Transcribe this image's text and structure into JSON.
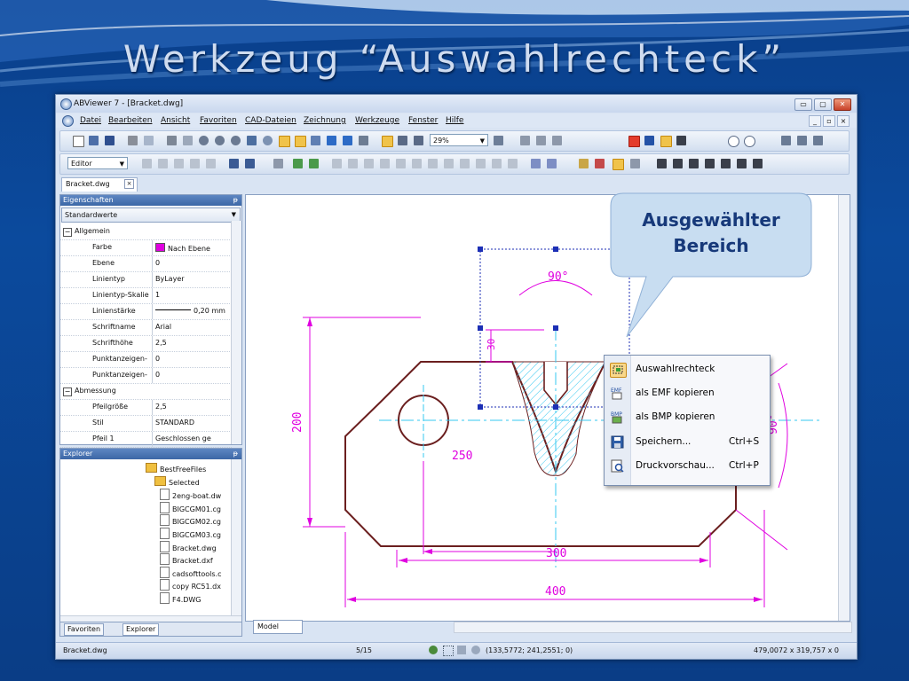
{
  "slide": {
    "title": "Werkzeug “Auswahlrechteck”"
  },
  "window": {
    "title": "ABViewer 7 - [Bracket.dwg]",
    "buttons": [
      "▭",
      "▢",
      "✕"
    ]
  },
  "menu": {
    "items": [
      "Datei",
      "Bearbeiten",
      "Ansicht",
      "Favoriten",
      "CAD-Dateien",
      "Zeichnung",
      "Werkzeuge",
      "Fenster",
      "Hilfe"
    ],
    "mdi_buttons": [
      "_",
      "▫",
      "×"
    ]
  },
  "toolbar": {
    "zoom_value": "29%",
    "mode_value": "Editor"
  },
  "doc_tab": {
    "label": "Bracket.dwg"
  },
  "properties": {
    "header": "Eigenschaften",
    "preset": "Standardwerte",
    "rows": [
      {
        "type": "cat",
        "name": "Allgemein",
        "value": ""
      },
      {
        "type": "prop",
        "name": "Farbe",
        "value": "Nach Ebene",
        "swatch": "#e000e0"
      },
      {
        "type": "prop",
        "name": "Ebene",
        "value": "0"
      },
      {
        "type": "prop",
        "name": "Linientyp",
        "value": "ByLayer"
      },
      {
        "type": "prop",
        "name": "Linientyp-Skalie",
        "value": "1"
      },
      {
        "type": "prop",
        "name": "Linienstärke",
        "value": "0,20 mm",
        "line": true
      },
      {
        "type": "prop",
        "name": "Schriftname",
        "value": "Arial"
      },
      {
        "type": "prop",
        "name": "Schrifthöhe",
        "value": "2,5"
      },
      {
        "type": "prop",
        "name": "Punktanzeigen-",
        "value": "0"
      },
      {
        "type": "prop",
        "name": "Punktanzeigen-",
        "value": "0"
      },
      {
        "type": "cat",
        "name": "Abmessung",
        "value": ""
      },
      {
        "type": "prop",
        "name": "Pfeilgröße",
        "value": "2,5"
      },
      {
        "type": "prop",
        "name": "Stil",
        "value": "STANDARD"
      },
      {
        "type": "prop",
        "name": "Pfeil 1",
        "value": "Geschlossen ge"
      }
    ]
  },
  "explorer": {
    "header": "Explorer",
    "items": [
      "BestFreeFiles",
      "Selected",
      "2eng-boat.dw",
      "BIGCGM01.cg",
      "BIGCGM02.cg",
      "BIGCGM03.cg",
      "Bracket.dwg",
      "Bracket.dxf",
      "cadsofttools.c",
      "copy RC51.dx",
      "F4.DWG"
    ],
    "tabs": [
      "Favoriten",
      "Explorer"
    ]
  },
  "canvas": {
    "model_tab": "Model",
    "dims": {
      "angle_top": "90°",
      "depth": "30",
      "height": "200",
      "left_offset": "250",
      "inner_width": "300",
      "total_width": "400",
      "angle_right": "90°"
    }
  },
  "context_menu": {
    "items": [
      {
        "label": "Auswahlrechteck",
        "shortcut": "",
        "icon": "select-rect-icon"
      },
      {
        "label": "als EMF kopieren",
        "shortcut": "",
        "icon": "emf-icon"
      },
      {
        "label": "als BMP kopieren",
        "shortcut": "",
        "icon": "bmp-icon"
      },
      {
        "label": "Speichern...",
        "shortcut": "Ctrl+S",
        "icon": "save-icon"
      },
      {
        "label": "Druckvorschau...",
        "shortcut": "Ctrl+P",
        "icon": "print-preview-icon"
      }
    ]
  },
  "callout": {
    "line1": "Ausgewählter",
    "line2": "Bereich"
  },
  "status": {
    "file": "Bracket.dwg",
    "page": "5/15",
    "coords": "(133,5772; 241,2551; 0)",
    "size": "479,0072 x 319,757 x 0"
  },
  "colors": {
    "drawing": "#6b1f1f",
    "dimension": "#e000e0",
    "center": "#36c8f0",
    "selection": "#1c2fb5"
  }
}
